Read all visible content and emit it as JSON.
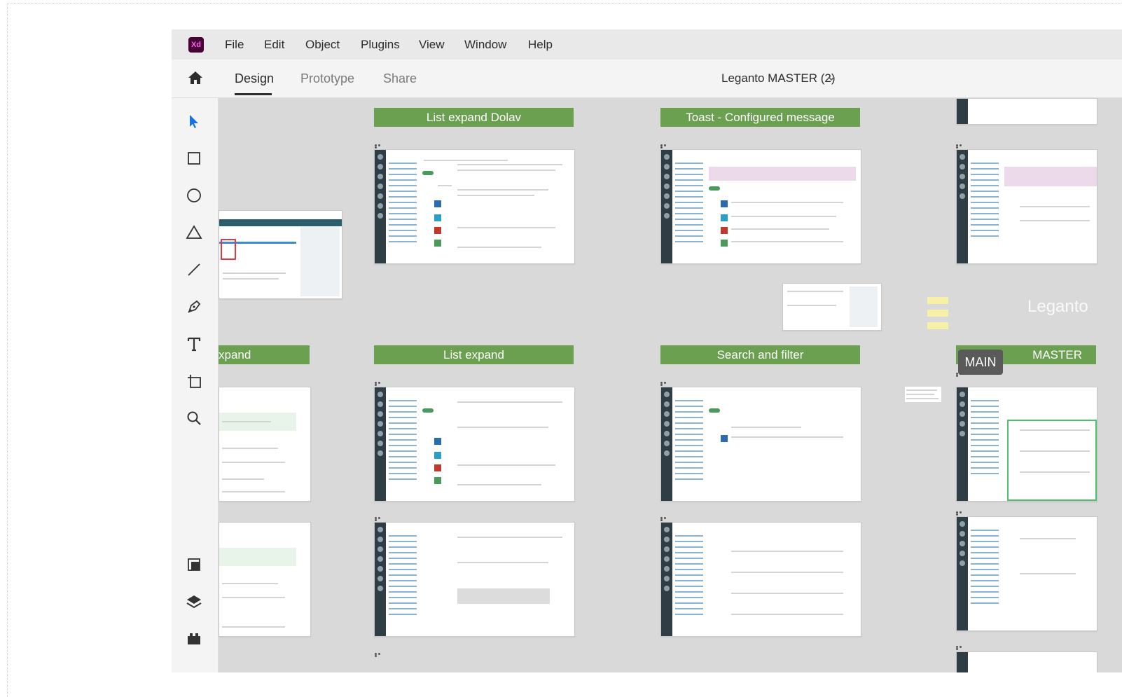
{
  "menubar": {
    "app_icon": "Xd",
    "items": [
      "File",
      "Edit",
      "Object",
      "Plugins",
      "View",
      "Window",
      "Help"
    ]
  },
  "tabbar": {
    "home_icon": "home-icon",
    "tabs": [
      {
        "label": "Design",
        "active": true
      },
      {
        "label": "Prototype",
        "active": false
      },
      {
        "label": "Share",
        "active": false
      }
    ],
    "document_title": "Leganto MASTER (2)"
  },
  "toolbar": {
    "tools": [
      "select-tool-icon",
      "rectangle-tool-icon",
      "ellipse-tool-icon",
      "polygon-tool-icon",
      "line-tool-icon",
      "pen-tool-icon",
      "text-tool-icon",
      "artboard-tool-icon",
      "zoom-tool-icon",
      "assets-icon",
      "layers-icon",
      "plugins-icon"
    ]
  },
  "canvas": {
    "labels": {
      "list_expand_dolav": "List expand Dolav",
      "toast_configured": "Toast - Configured message",
      "expand_partial": "xpand",
      "list_expand": "List expand",
      "search_and_filter": "Search and filter",
      "master": "MASTER"
    },
    "main_badge": "MAIN",
    "watermark": "Leganto"
  },
  "colors": {
    "label_green": "#6aa050",
    "canvas_bg": "#d9d9d9",
    "xd_purple": "#470137",
    "xd_pink": "#ff61f6",
    "select_blue": "#1473e6"
  }
}
